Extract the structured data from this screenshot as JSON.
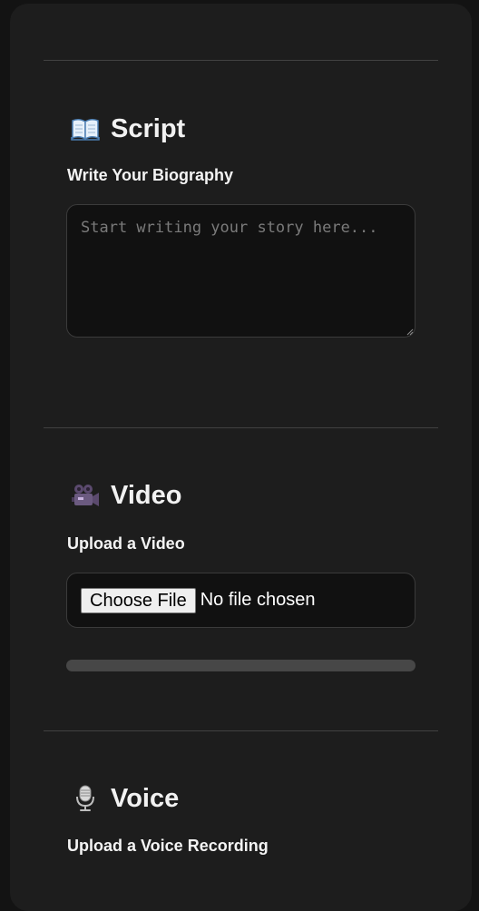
{
  "script": {
    "title": "Script",
    "icon": "open-book-icon",
    "label": "Write Your Biography",
    "placeholder": "Start writing your story here...",
    "value": ""
  },
  "video": {
    "title": "Video",
    "icon": "movie-camera-icon",
    "label": "Upload a Video",
    "choose_button": "Choose File",
    "file_status": "No file chosen",
    "progress": 0
  },
  "voice": {
    "title": "Voice",
    "icon": "microphone-icon",
    "label": "Upload a Voice Recording"
  }
}
